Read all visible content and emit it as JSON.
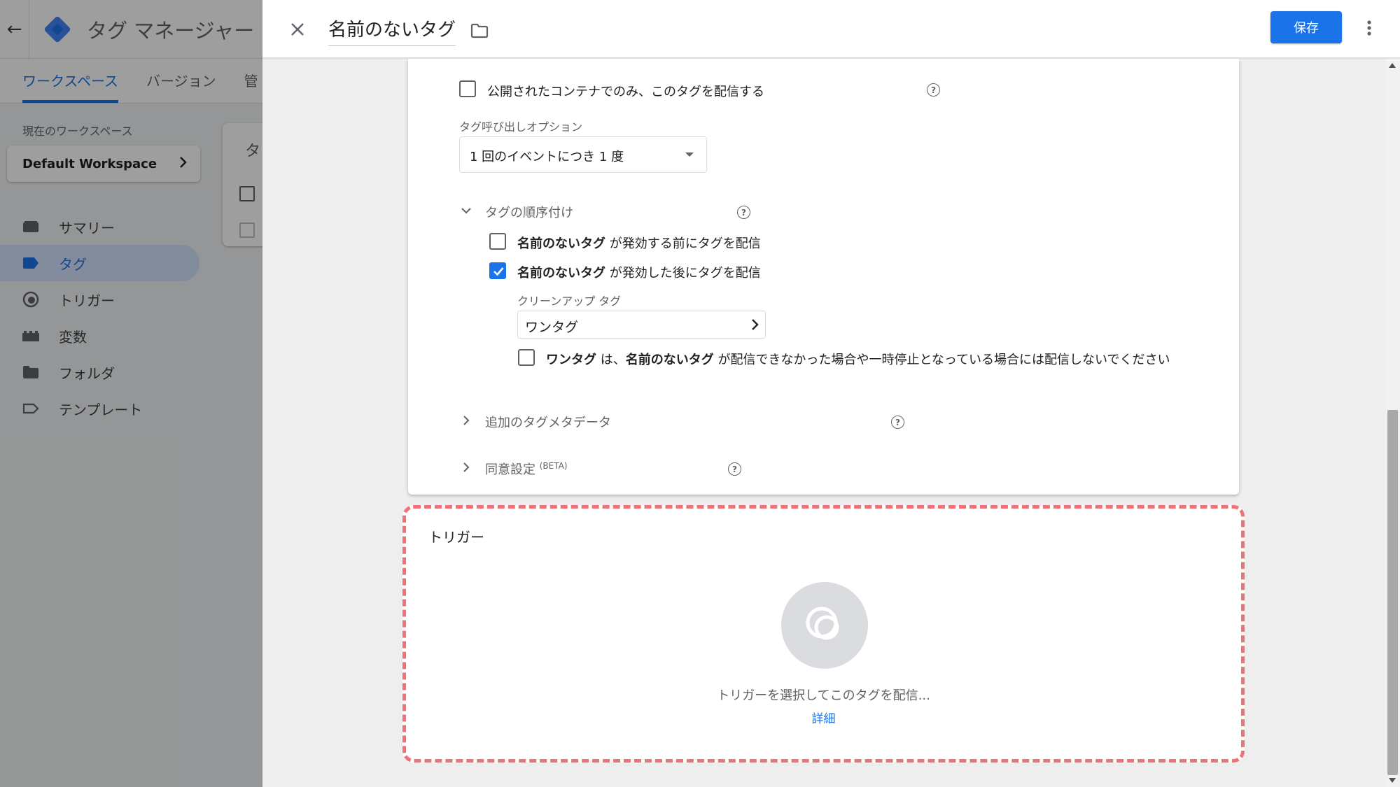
{
  "bg_app": {
    "title": "タグ マネージャー",
    "tabs": [
      "ワークスペース",
      "バージョン",
      "管"
    ],
    "workspace_label": "現在のワークスペース",
    "workspace_name": "Default Workspace",
    "nav": [
      {
        "label": "サマリー",
        "icon": "summary-icon"
      },
      {
        "label": "タグ",
        "icon": "tag-icon",
        "active": true
      },
      {
        "label": "トリガー",
        "icon": "trigger-icon"
      },
      {
        "label": "変数",
        "icon": "variable-icon"
      },
      {
        "label": "フォルダ",
        "icon": "folder-icon"
      },
      {
        "label": "テンプレート",
        "icon": "template-icon"
      }
    ],
    "card_title": "タ"
  },
  "header": {
    "tag_name": "名前のないタグ",
    "save_label": "保存"
  },
  "config": {
    "publish_only": {
      "label": "公開されたコンテナでのみ、このタグを配信する",
      "checked": false
    },
    "firing_option": {
      "label": "タグ呼び出しオプション",
      "value": "1 回のイベントにつき 1 度"
    },
    "sequencing": {
      "title": "タグの順序付け",
      "before": {
        "bold": "名前のないタグ",
        "text": " が発効する前にタグを配信",
        "checked": false
      },
      "after": {
        "bold": "名前のないタグ",
        "text": " が発効した後にタグを配信",
        "checked": true
      },
      "cleanup_label": "クリーンアップ タグ",
      "cleanup_value": "ワンタグ",
      "dont_fire": {
        "bold1": "ワンタグ",
        "text1": " は、",
        "bold2": "名前のないタグ",
        "text2": " が配信できなかった場合や一時停止となっている場合には配信しないでください",
        "checked": false
      }
    },
    "metadata_title": "追加のタグメタデータ",
    "consent_title": "同意設定",
    "consent_badge": "(BETA)"
  },
  "trigger": {
    "title": "トリガー",
    "hint": "トリガーを選択してこのタグを配信...",
    "link": "詳細"
  },
  "colors": {
    "primary": "#1a73e8",
    "highlight_border": "#f0717a"
  }
}
